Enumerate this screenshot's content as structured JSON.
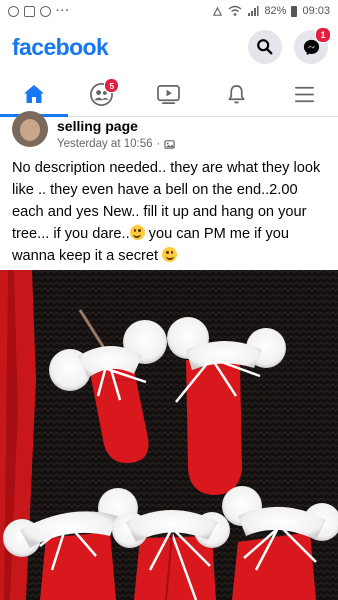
{
  "status_bar": {
    "battery_percent": "82%",
    "time": "09:03",
    "more_dots": "···"
  },
  "header": {
    "logo_text": "facebook",
    "messenger_badge": "1"
  },
  "tabs": {
    "friends_badge": "5",
    "active_tab": "home"
  },
  "post": {
    "author": "selling page",
    "timestamp": "Yesterday at 10:56",
    "separator": "·",
    "text_part1": "No description needed.. they are what they look like .. they even have a bell on the end..2.00 each and yes New.. fill it up and hang on your tree... if you dare..",
    "text_part2": " you can PM me if you wanna keep it a secret ",
    "photo_description_icons": [
      "laughing-emoji",
      "winking-emoji"
    ]
  },
  "colors": {
    "brand_blue": "#1877f2",
    "badge_red": "#e41e3f",
    "text_dark": "#050505",
    "text_secondary": "#65676b",
    "icon_bg": "#e4e6eb"
  }
}
